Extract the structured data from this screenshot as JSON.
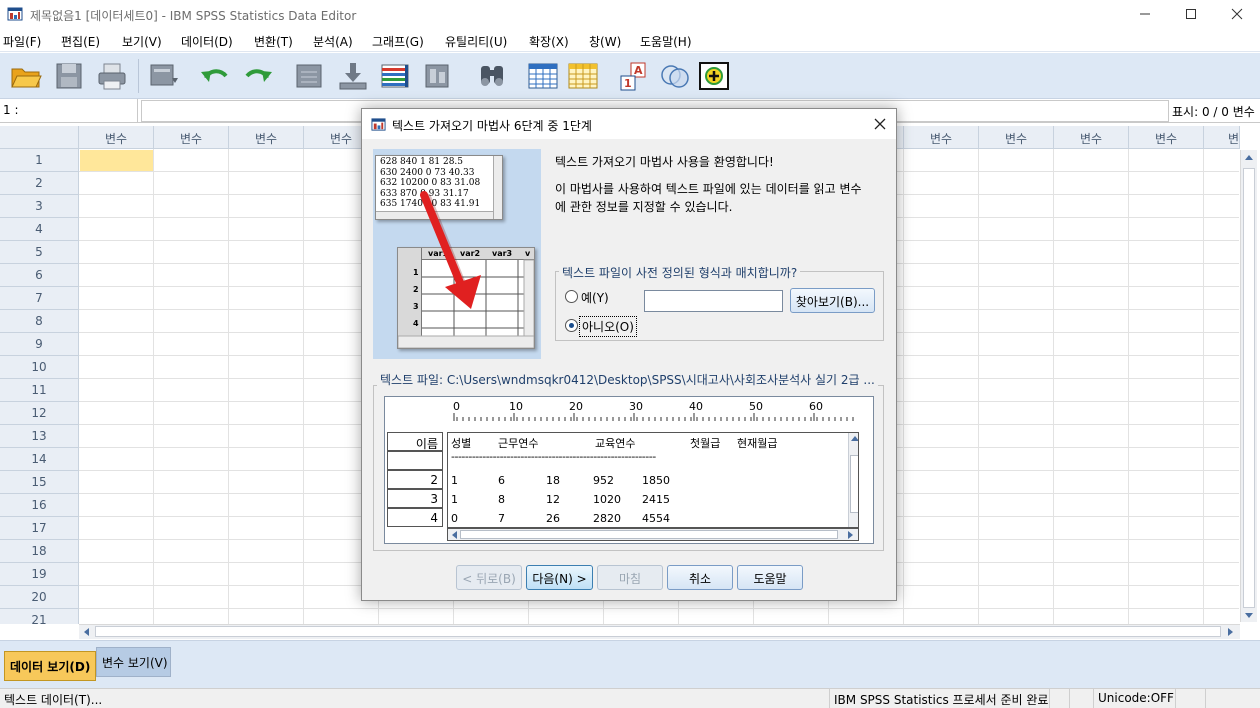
{
  "window": {
    "title": "제목없음1 [데이터세트0] - IBM SPSS Statistics Data Editor",
    "icon": "spss-app-icon"
  },
  "menu": [
    "파일(F)",
    "편집(E)",
    "보기(V)",
    "데이터(D)",
    "변환(T)",
    "분석(A)",
    "그래프(G)",
    "유틸리티(U)",
    "확장(X)",
    "창(W)",
    "도움말(H)"
  ],
  "toolbar": {
    "icons": [
      "open-folder-icon",
      "save-icon",
      "print-icon",
      "recall-dialog-icon",
      "undo-icon",
      "redo-icon",
      "goto-case-icon",
      "goto-variable-icon",
      "variables-icon",
      "run-descriptives-icon",
      "find-icon",
      "split-file-icon",
      "select-cases-icon",
      "value-labels-icon",
      "use-variable-sets-icon",
      "spelling-icon"
    ]
  },
  "cell_editor": {
    "ref": "1 :",
    "display_count": "표시: 0 / 0 변수"
  },
  "grid": {
    "column_header": "변수",
    "rows": [
      "1",
      "2",
      "3",
      "4",
      "5",
      "6",
      "7",
      "8",
      "9",
      "10",
      "11",
      "12",
      "13",
      "14",
      "15",
      "16",
      "17",
      "18",
      "19",
      "20",
      "21"
    ]
  },
  "view_tabs": {
    "data_view": "데이터 보기(D)",
    "variable_view": "변수 보기(V)"
  },
  "status": {
    "left": "텍스트 데이터(T)...",
    "processor": "IBM SPSS Statistics 프로세서 준비 완료",
    "unicode": "Unicode:OFF"
  },
  "dialog": {
    "title": "텍스트 가져오기 마법사 6단계 중 1단계",
    "welcome": "텍스트 가져오기 마법사 사용을 환영합니다!",
    "desc_line1": "이 마법사를 사용하여 텍스트 파일에 있는 데이터를 읽고 변수",
    "desc_line2": "에 관한 정보를 지정할 수 있습니다.",
    "illustration": {
      "text_lines": [
        "628 840 1 81 28.5",
        "630 2400 0 73 40.33",
        "632 10200 0 83 31.08",
        "633 870 0 93 31.17",
        "635 17400 0 83 41.91"
      ],
      "vars": [
        "var1",
        "var2",
        "var3",
        "v"
      ],
      "rows": [
        "1",
        "2",
        "3",
        "4"
      ]
    },
    "format_group": {
      "legend": "텍스트 파일이 사전 정의된 형식과 매치합니까?",
      "yes": "예(Y)",
      "no": "아니오(O)",
      "selected": "아니오(O)",
      "path_value": "",
      "browse": "찾아보기(B)..."
    },
    "file_group": {
      "legend": "텍스트 파일: C:\\Users\\wndmsqkr0412\\Desktop\\SPSS\\시대고사\\사회조사분석사 실기 2급 ...",
      "ruler_ticks": [
        "0",
        "10",
        "20",
        "30",
        "40",
        "50",
        "60"
      ],
      "row_header_label": "이름",
      "row_numbers": [
        "",
        "2",
        "3",
        "4"
      ],
      "header_line": [
        "성별",
        "근무연수",
        "교육연수",
        "첫월급",
        "현재월급"
      ],
      "separator": "-----------------------------------------------------------",
      "data_rows": [
        [
          "1",
          "6",
          "18",
          "952",
          "1850"
        ],
        [
          "1",
          "8",
          "12",
          "1020",
          "2415"
        ],
        [
          "0",
          "7",
          "26",
          "2820",
          "4554"
        ]
      ]
    },
    "buttons": {
      "back": "< 뒤로(B)",
      "next": "다음(N) >",
      "finish": "마침",
      "cancel": "취소",
      "help": "도움말"
    }
  }
}
